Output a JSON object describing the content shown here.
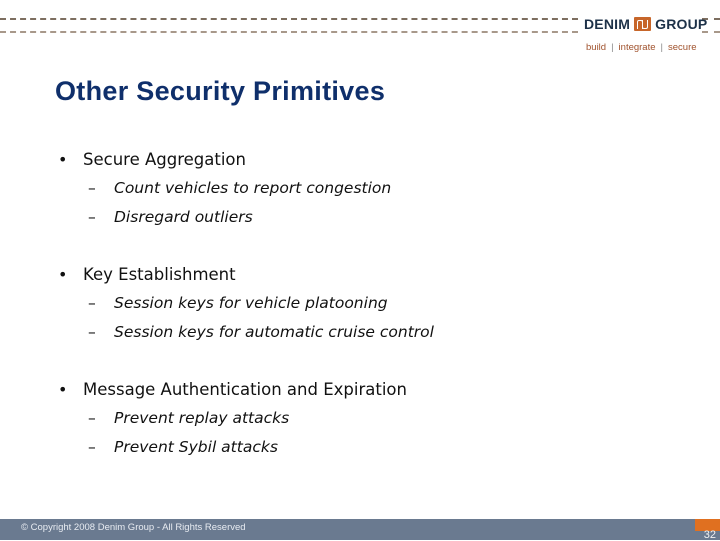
{
  "header": {
    "logo": {
      "left_text": "DENIM",
      "right_text": "GROUP",
      "mark_icon": "denim-group-logo-mark",
      "tagline": [
        "build",
        "integrate",
        "secure"
      ],
      "tagline_separator": "|"
    }
  },
  "slide": {
    "title": "Other Security Primitives",
    "bullets": [
      {
        "text": "Secure Aggregation",
        "subitems": [
          "Count vehicles to report congestion",
          "Disregard outliers"
        ]
      },
      {
        "text": "Key Establishment",
        "subitems": [
          "Session keys for vehicle platooning",
          "Session keys for automatic cruise control"
        ]
      },
      {
        "text": "Message Authentication and Expiration",
        "subitems": [
          "Prevent replay attacks",
          "Prevent Sybil attacks"
        ]
      }
    ],
    "bullet_glyph": "•",
    "subitem_glyph": "–"
  },
  "footer": {
    "copyright": "© Copyright 2008 Denim Group - All Rights Reserved",
    "page_number": "32"
  },
  "colors": {
    "title": "#0f2f6b",
    "footer_bg": "#6a7a90",
    "accent_orange": "#e07020",
    "logo_text": "#1d3148"
  }
}
